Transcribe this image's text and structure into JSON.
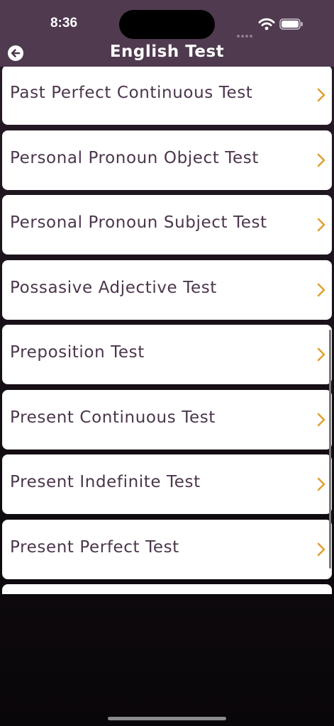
{
  "status_bar": {
    "time": "8:36"
  },
  "header": {
    "title": "English Test",
    "back_icon": "arrow-left-circle-icon"
  },
  "list": {
    "chevron_icon": "chevron-right-icon",
    "chevron_color": "#e0a030",
    "text_color": "#4b364b",
    "items": [
      {
        "label": "Past Perfect Continuous Test"
      },
      {
        "label": "Personal Pronoun Object Test"
      },
      {
        "label": "Personal Pronoun Subject Test"
      },
      {
        "label": "Possasive Adjective Test"
      },
      {
        "label": "Preposition Test"
      },
      {
        "label": "Present Continuous Test"
      },
      {
        "label": "Present Indefinite Test"
      },
      {
        "label": "Present Perfect Test"
      }
    ]
  },
  "colors": {
    "header_background": "#4f3a4f",
    "page_background": "#1a121a"
  }
}
